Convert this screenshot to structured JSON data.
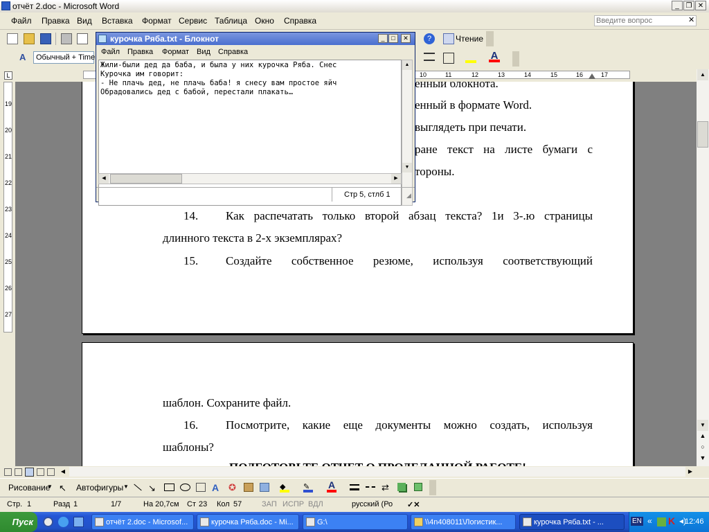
{
  "word": {
    "title": "отчёт 2.doc - Microsoft Word",
    "menu": [
      "Файл",
      "Правка",
      "Вид",
      "Вставка",
      "Формат",
      "Сервис",
      "Таблица",
      "Окно",
      "Справка"
    ],
    "ask_placeholder": "Введите вопрос",
    "style_box": "Обычный + Time",
    "reading_label": "Чтение",
    "ruler_numbers": [
      "10",
      "11",
      "12",
      "13",
      "14",
      "15",
      "16",
      "17"
    ],
    "vruler_numbers": [
      "19",
      "20",
      "21",
      "22",
      "23",
      "24",
      "25",
      "26",
      "27"
    ]
  },
  "document": {
    "fragments": [
      "енный блокнота.",
      "енный в формате Word.",
      "выглядеть при печати.",
      "ране текст на листе бумаги с",
      "тороны."
    ],
    "item14_num": "14.",
    "item14_text": "Как распечатать только второй абзац текста? 1и 3-.ю страницы",
    "item14_cont": "длинного текста в 2-х экземплярах?",
    "item15_num": "15.",
    "item15_text": "Создайте собственное резюме, используя соответствующий",
    "page2_line1": "шаблон. Сохраните файл.",
    "item16_num": "16.",
    "item16_text": "Посмотрите, какие еще документы можно создать, используя",
    "item16_cont": "шаблоны?",
    "heading_partial": "ПОДГОТОВЬТЕ ОТЧЕТ О ПРОДЕЛАННОЙ РАБОТЕ!"
  },
  "notepad": {
    "title": "курочка Ряба.txt - Блокнот",
    "menu": [
      "Файл",
      "Правка",
      "Формат",
      "Вид",
      "Справка"
    ],
    "text": "Жили-были дед да баба, и была у них курочка Ряба. Снес\nКурочка им говорит:\n- Не плачь дед, не плачь баба! я снесу вам простое яйч\nОбрадовались дед с бабой, перестали плакать…",
    "status": "Стр 5, стлб 1"
  },
  "drawbar": {
    "drawing": "Рисование",
    "autoshapes": "Автофигуры"
  },
  "status": {
    "page": "Стр.",
    "page_val": "1",
    "section": "Разд",
    "section_val": "1",
    "pages": "1/7",
    "at": "На 20,7см",
    "line": "Ст",
    "line_val": "23",
    "col": "Кол",
    "col_val": "57",
    "rec": "ЗАП",
    "trk": "ИСПР",
    "ext": "ВДЛ",
    "lang": "русский (Ро"
  },
  "taskbar": {
    "start": "Пуск",
    "tasks": [
      "отчёт 2.doc - Microsof...",
      "курочка Ряба.doc - Mi...",
      "G:\\",
      "\\\\4n408011\\Логистик...",
      "курочка Ряба.txt - ..."
    ],
    "lang": "EN",
    "clock": "12:46"
  }
}
